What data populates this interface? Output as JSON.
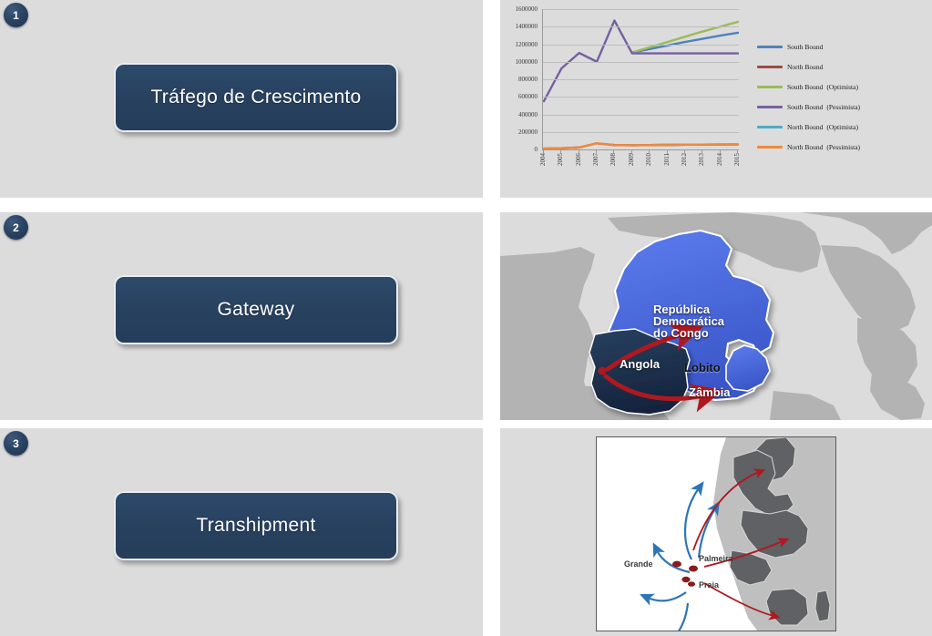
{
  "slides": [
    {
      "number": "1",
      "title": "Tráfego de Crescimento"
    },
    {
      "number": "2",
      "title": "Gateway"
    },
    {
      "number": "3",
      "title": "Transhipment"
    }
  ],
  "chart_data": {
    "type": "line",
    "title": "",
    "xlabel": "",
    "ylabel": "",
    "ylim": [
      0,
      1600000
    ],
    "ytick_labels": [
      "1600000",
      "1400000",
      "1200000",
      "1000000",
      "800000",
      "600000",
      "400000",
      "200000",
      "0"
    ],
    "ytick_values": [
      1600000,
      1400000,
      1200000,
      1000000,
      800000,
      600000,
      400000,
      200000,
      0
    ],
    "grid": true,
    "legend_position": "right",
    "categories": [
      "2004",
      "2005",
      "2006",
      "2007",
      "2008",
      "2009",
      "2010",
      "2011",
      "2012",
      "2013",
      "2014",
      "2015"
    ],
    "series": [
      {
        "name": "South Bound",
        "name_main": "South Bound",
        "name_sub": "",
        "color": "#4F81BD",
        "values": [
          null,
          null,
          null,
          null,
          null,
          1105000,
          1145000,
          1185000,
          1225000,
          1262000,
          1298000,
          1330000
        ]
      },
      {
        "name": "North Bound",
        "name_main": "North Bound",
        "name_sub": "",
        "color": "#9E4A41",
        "values": [
          9000,
          14000,
          22000,
          70000,
          50000,
          48000,
          50000,
          52000,
          54000,
          55000,
          56000,
          57000
        ]
      },
      {
        "name": "South Bound  (Optimista)",
        "name_main": "South Bound",
        "name_sub": "(Optimista)",
        "color": "#9BBB59",
        "values": [
          null,
          null,
          null,
          null,
          null,
          1105000,
          1165000,
          1225000,
          1285000,
          1345000,
          1400000,
          1455000
        ]
      },
      {
        "name": "South Bound  (Pessimista)",
        "name_main": "South Bound",
        "name_sub": "(Pessimista)",
        "color": "#7760A1",
        "values": [
          550000,
          925000,
          1100000,
          1000000,
          1470000,
          1095000,
          1095000,
          1095000,
          1095000,
          1095000,
          1095000,
          1095000
        ]
      },
      {
        "name": "North Bound  (Optimista)",
        "name_main": "North Bound",
        "name_sub": "(Optimista)",
        "color": "#4BACC6",
        "values": [
          null,
          null,
          null,
          null,
          null,
          48000,
          50000,
          52000,
          54000,
          55000,
          56000,
          58000
        ]
      },
      {
        "name": "North Bound  (Pessimista)",
        "name_main": "North Bound",
        "name_sub": "(Pessimista)",
        "color": "#F0883C",
        "values": [
          9000,
          14000,
          22000,
          70000,
          50000,
          48000,
          50000,
          52000,
          54000,
          55000,
          56000,
          57000
        ]
      }
    ]
  },
  "map_gateway": {
    "labels": {
      "drc_line1": "República",
      "drc_line2": "Democrática",
      "drc_line3": "do Congo",
      "angola": "Angola",
      "zambia": "Zâmbia",
      "lobito": "Lobito"
    },
    "colors": {
      "highlight": "#4A6BE0",
      "angola": "#1E3254",
      "landmass": "#b3b3b3",
      "arrow": "#B01820"
    }
  },
  "map_transhipment": {
    "labels": {
      "grande": "Grande",
      "palmeira": "Palmeira",
      "praia": "Praia"
    },
    "colors": {
      "inbound_arrow": "#2E75B6",
      "outbound_arrow": "#B01820",
      "land_dark": "#5F6164",
      "land_light": "#BFBFBF",
      "port_dot": "#8B1A1A"
    }
  }
}
